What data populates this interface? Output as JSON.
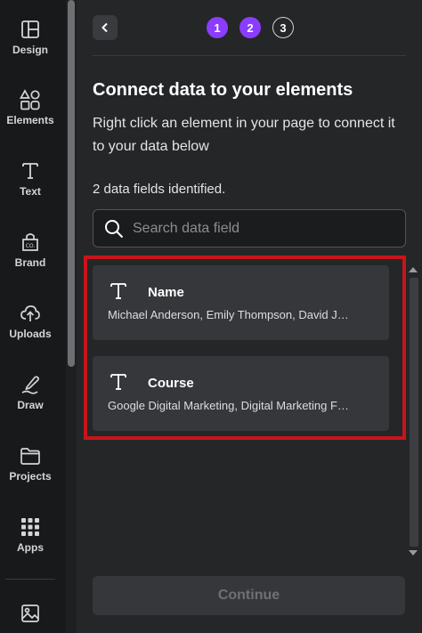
{
  "sidebar": {
    "items": [
      {
        "label": "Design",
        "icon": "layout-icon"
      },
      {
        "label": "Elements",
        "icon": "shapes-icon"
      },
      {
        "label": "Text",
        "icon": "text-icon"
      },
      {
        "label": "Brand",
        "icon": "brand-icon"
      },
      {
        "label": "Uploads",
        "icon": "upload-cloud-icon"
      },
      {
        "label": "Draw",
        "icon": "draw-icon"
      },
      {
        "label": "Projects",
        "icon": "folder-icon"
      },
      {
        "label": "Apps",
        "icon": "apps-grid-icon"
      }
    ],
    "bottom_icon": "image-icon"
  },
  "stepper": {
    "steps": [
      "1",
      "2",
      "3"
    ],
    "active_color": "#8b3dff"
  },
  "panel": {
    "title": "Connect data to your elements",
    "description": "Right click an element in your page to connect it to your data below",
    "fields_count_text": "2 data fields identified.",
    "search_placeholder": "Search data field",
    "fields": [
      {
        "name": "Name",
        "values": "Michael Anderson, Emily Thompson, David J…"
      },
      {
        "name": "Course",
        "values": "Google Digital Marketing, Digital Marketing F…"
      }
    ],
    "continue_label": "Continue",
    "highlight_color": "#c8141c"
  }
}
